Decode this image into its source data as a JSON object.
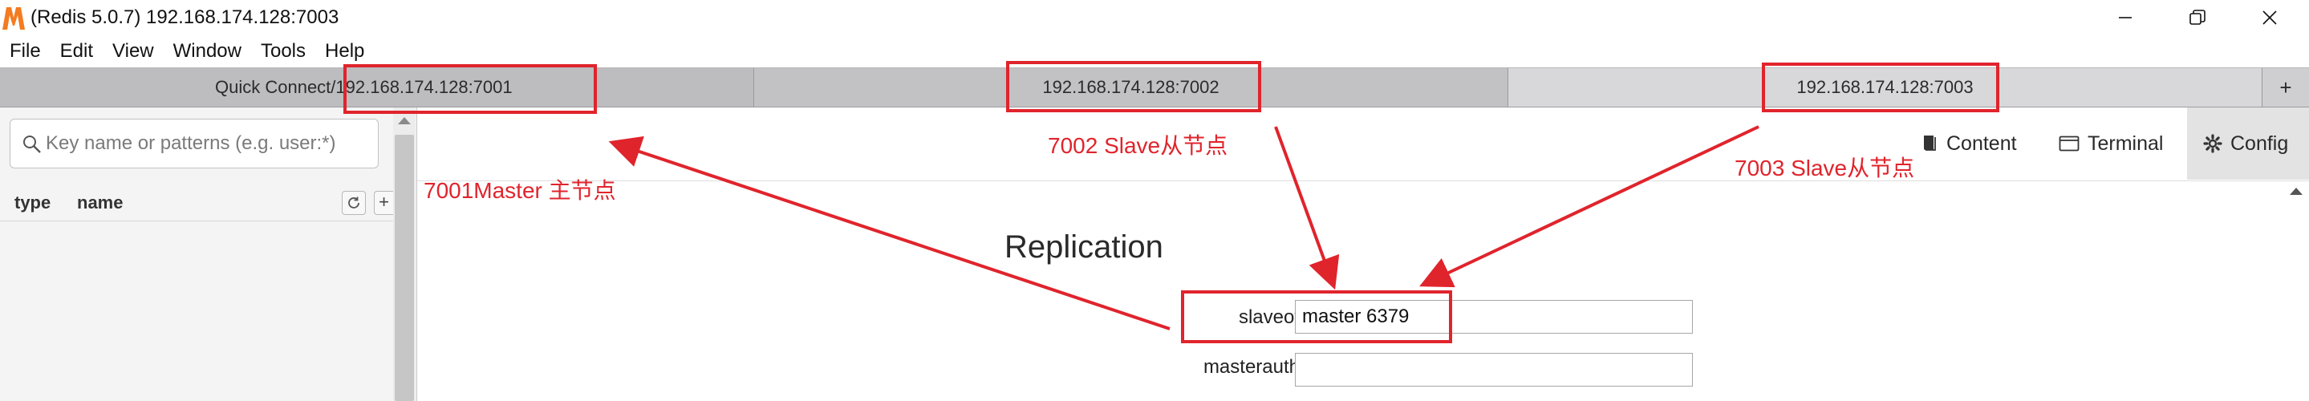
{
  "window": {
    "title": "(Redis 5.0.7) 192.168.174.128:7003",
    "logo_letter": "M"
  },
  "menu": [
    "File",
    "Edit",
    "View",
    "Window",
    "Tools",
    "Help"
  ],
  "tabs": {
    "quick_connect": "Quick Connect/192.168.174.128:7001",
    "tab2": "192.168.174.128:7002",
    "tab3": "192.168.174.128:7003",
    "add": "+"
  },
  "sidebar": {
    "search_placeholder": "Key name or patterns (e.g. user:*)",
    "columns": {
      "type": "type",
      "name": "name"
    },
    "add_key": "+"
  },
  "toolbar": {
    "content": "Content",
    "terminal": "Terminal",
    "config": "Config"
  },
  "replication": {
    "title": "Replication",
    "slaveof_label": "slaveof",
    "slaveof_value": "master 6379",
    "masterauth_label": "masterauth",
    "masterauth_value": ""
  },
  "annotations": {
    "color": "#e0242c",
    "master_note": "7001Master 主节点",
    "slave_7002_note": "7002 Slave从节点",
    "slave_7003_note": "7003 Slave从节点"
  },
  "colors": {
    "logo_orange": "#f47b20",
    "config_active_bg": "#e3e3e3",
    "annotation_red": "#e0242c"
  }
}
